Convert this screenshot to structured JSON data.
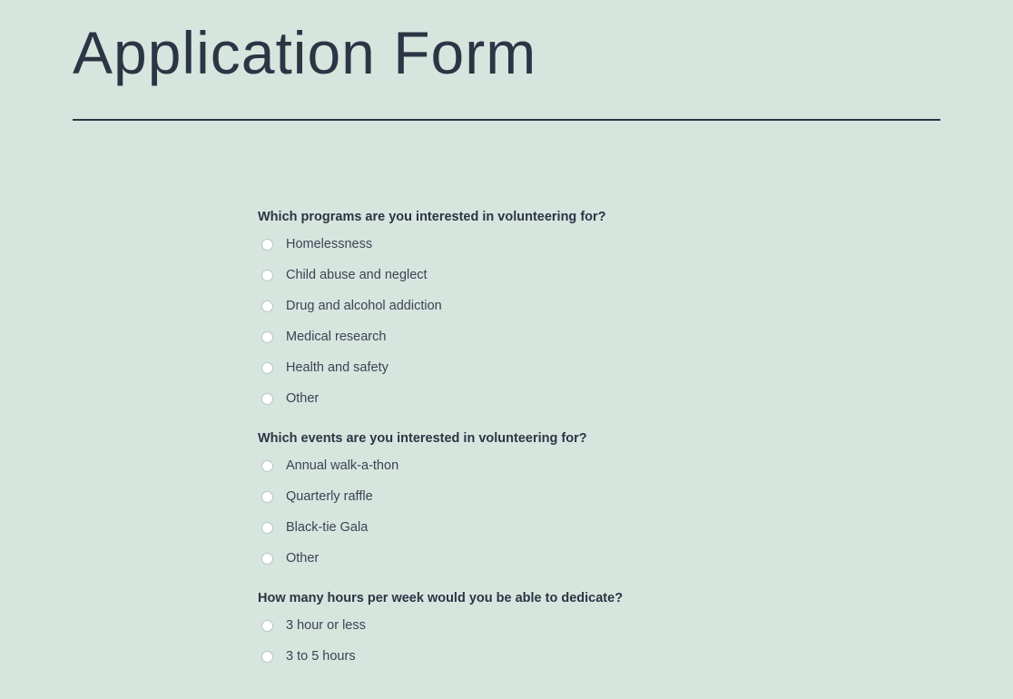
{
  "header": {
    "title": "Application Form"
  },
  "questions": [
    {
      "label": "Which programs are you interested in volunteering for?",
      "options": [
        "Homelessness",
        "Child abuse and neglect",
        "Drug and alcohol addiction",
        "Medical research",
        "Health and safety",
        "Other"
      ]
    },
    {
      "label": "Which events are you interested in volunteering for?",
      "options": [
        "Annual walk-a-thon",
        "Quarterly raffle",
        "Black-tie Gala",
        "Other"
      ]
    },
    {
      "label": "How many hours per week would you be able to dedicate?",
      "options": [
        "3 hour or less",
        "3 to 5 hours"
      ]
    }
  ]
}
